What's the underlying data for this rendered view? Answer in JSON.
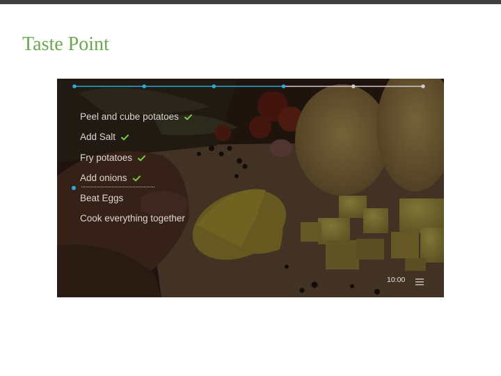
{
  "slide": {
    "title": "Taste Point"
  },
  "recipe": {
    "steps": [
      {
        "label": "Peel and cube potatoes",
        "done": true
      },
      {
        "label": "Add Salt",
        "done": true
      },
      {
        "label": "Fry potatoes",
        "done": true
      },
      {
        "label": "Add onions",
        "done": true
      },
      {
        "label": "Beat Eggs",
        "done": false
      },
      {
        "label": "Cook everything together",
        "done": false
      }
    ],
    "progress": {
      "total_stages": 6,
      "completed_stages": 4
    }
  },
  "status": {
    "time": "10:00"
  },
  "icons": {
    "check": "check-icon",
    "menu": "hamburger-menu-icon"
  },
  "colors": {
    "title": "#6aa84f",
    "accent": "#2ea8d8",
    "check": "#7ccc3c",
    "inactive": "#cfcaca"
  }
}
